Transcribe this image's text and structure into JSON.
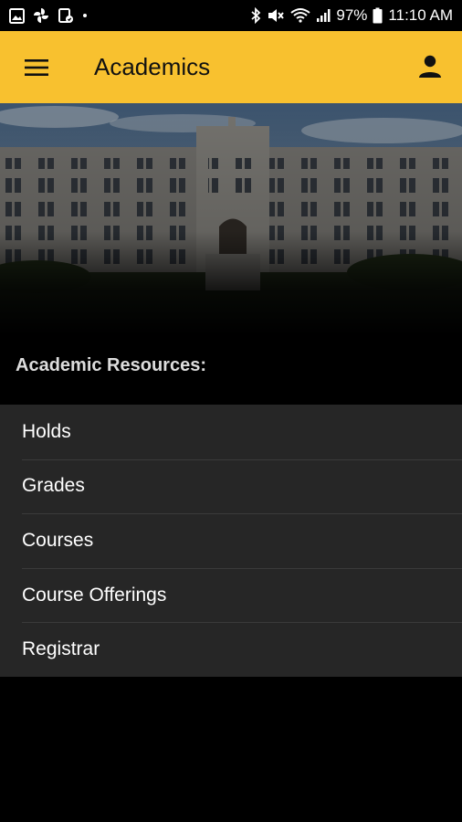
{
  "status_bar": {
    "battery": "97%",
    "time": "11:10 AM",
    "left_icons": [
      "image-icon",
      "pinwheel-icon",
      "clipboard-icon",
      "dot-icon"
    ],
    "right_icons": [
      "bluetooth-icon",
      "mute-icon",
      "wifi-icon",
      "signal-icon",
      "battery-icon"
    ]
  },
  "app_bar": {
    "title": "Academics",
    "background": "#F8C12F",
    "menu_icon": "hamburger-menu-icon",
    "account_icon": "person-icon"
  },
  "hero": {
    "image": "campus-building-image"
  },
  "resources": {
    "heading": "Academic Resources:",
    "items": [
      {
        "label": "Holds"
      },
      {
        "label": "Grades"
      },
      {
        "label": "Courses"
      },
      {
        "label": "Course Offerings"
      },
      {
        "label": "Registrar"
      }
    ]
  }
}
